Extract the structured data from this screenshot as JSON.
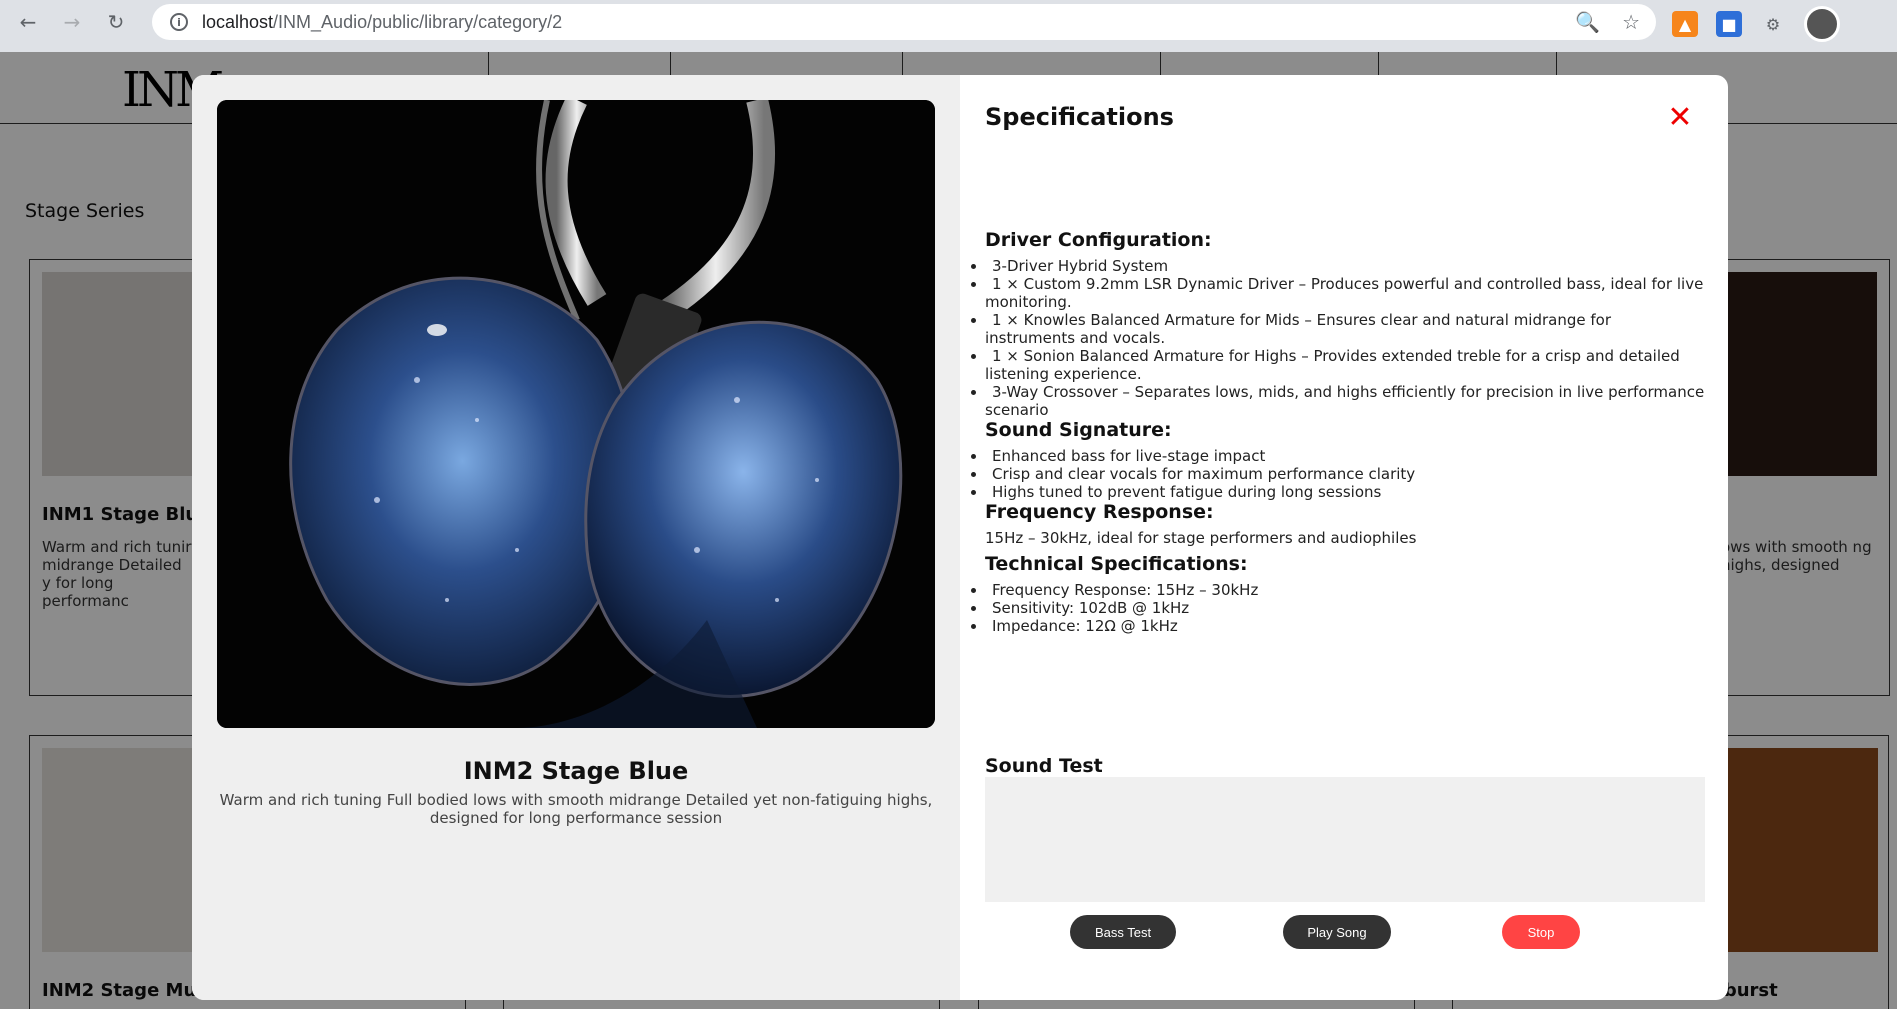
{
  "browser": {
    "url_host": "localhost",
    "url_path": "/INM_Audio/public/library/category/2"
  },
  "site": {
    "logo": "INM",
    "category_title": "Stage Series"
  },
  "background_cards": [
    {
      "name": "INM1 Stage Blu",
      "desc": "Warm and rich tunir midrange Detailed y for long performanc"
    },
    {
      "name": "",
      "desc": "ows with smooth ng highs, designed"
    },
    {
      "name": "INM2 Stage Mu",
      "desc": ""
    },
    {
      "name": "uburst",
      "desc": ""
    }
  ],
  "modal": {
    "product_name": "INM2 Stage Blue",
    "product_desc": "Warm and rich tuning Full bodied lows with smooth midrange Detailed yet non-fatiguing highs, designed for long performance session",
    "spec_title": "Specifications",
    "sections": {
      "driver_title": "Driver Configuration:",
      "driver_items": [
        "3-Driver Hybrid System",
        "1 × Custom 9.2mm LSR Dynamic Driver – Produces powerful and controlled bass, ideal for live monitoring.",
        "1 × Knowles Balanced Armature for Mids – Ensures clear and natural midrange for instruments and vocals.",
        "1 × Sonion Balanced Armature for Highs – Provides extended treble for a crisp and detailed listening experience.",
        "3-Way Crossover – Separates lows, mids, and highs efficiently for precision in live performance scenario"
      ],
      "sound_title": "Sound Signature:",
      "sound_items": [
        "Enhanced bass for live-stage impact",
        "Crisp and clear vocals for maximum performance clarity",
        "Highs tuned to prevent fatigue during long sessions"
      ],
      "freq_title": "Frequency Response:",
      "freq_text": "15Hz – 30kHz, ideal for stage performers and audiophiles",
      "tech_title": "Technical Specifications:",
      "tech_items": [
        "Frequency Response: 15Hz – 30kHz",
        "Sensitivity: 102dB @ 1kHz",
        "Impedance: 12Ω @ 1kHz"
      ]
    },
    "sound_test_title": "Sound Test",
    "buttons": {
      "bass_test": "Bass Test",
      "play_song": "Play Song",
      "stop": "Stop"
    },
    "close_glyph": "✕"
  }
}
